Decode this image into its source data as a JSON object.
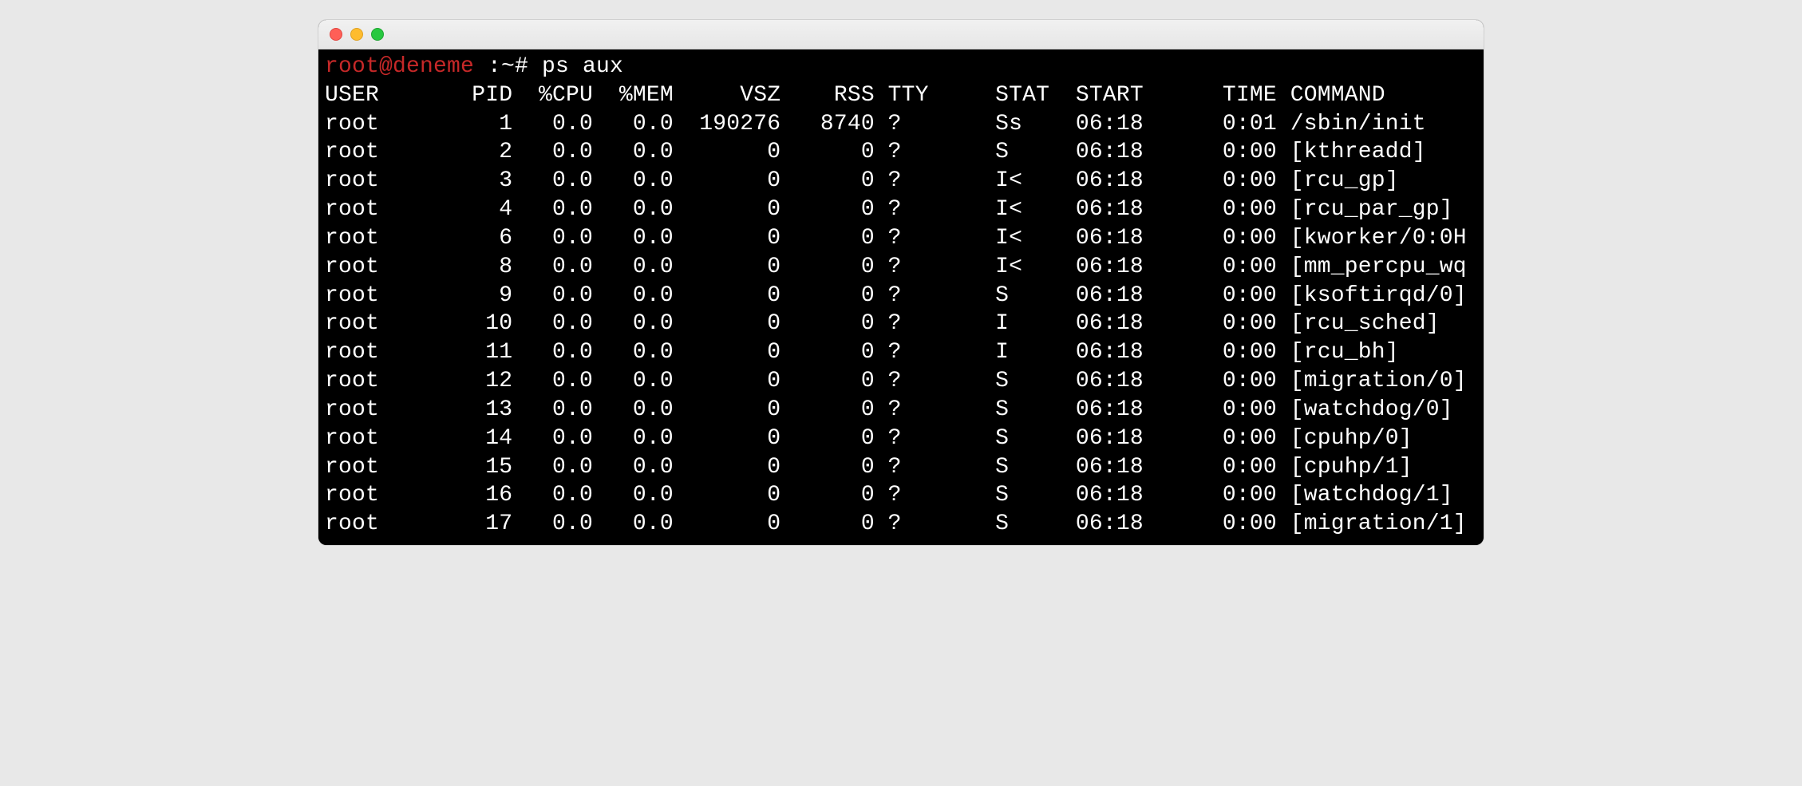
{
  "prompt": {
    "userhost": "root@deneme",
    "rest": " :~# ",
    "command": "ps aux"
  },
  "headers": {
    "user": "USER",
    "pid": "PID",
    "cpu": "%CPU",
    "mem": "%MEM",
    "vsz": "VSZ",
    "rss": "RSS",
    "tty": "TTY",
    "stat": "STAT",
    "start": "START",
    "time": "TIME",
    "cmd": "COMMAND"
  },
  "rows": [
    {
      "user": "root",
      "pid": "1",
      "cpu": "0.0",
      "mem": "0.0",
      "vsz": "190276",
      "rss": "8740",
      "tty": "?",
      "stat": "Ss",
      "start": "06:18",
      "time": "0:01",
      "cmd": "/sbin/init"
    },
    {
      "user": "root",
      "pid": "2",
      "cpu": "0.0",
      "mem": "0.0",
      "vsz": "0",
      "rss": "0",
      "tty": "?",
      "stat": "S",
      "start": "06:18",
      "time": "0:00",
      "cmd": "[kthreadd]"
    },
    {
      "user": "root",
      "pid": "3",
      "cpu": "0.0",
      "mem": "0.0",
      "vsz": "0",
      "rss": "0",
      "tty": "?",
      "stat": "I<",
      "start": "06:18",
      "time": "0:00",
      "cmd": "[rcu_gp]"
    },
    {
      "user": "root",
      "pid": "4",
      "cpu": "0.0",
      "mem": "0.0",
      "vsz": "0",
      "rss": "0",
      "tty": "?",
      "stat": "I<",
      "start": "06:18",
      "time": "0:00",
      "cmd": "[rcu_par_gp]"
    },
    {
      "user": "root",
      "pid": "6",
      "cpu": "0.0",
      "mem": "0.0",
      "vsz": "0",
      "rss": "0",
      "tty": "?",
      "stat": "I<",
      "start": "06:18",
      "time": "0:00",
      "cmd": "[kworker/0:0H"
    },
    {
      "user": "root",
      "pid": "8",
      "cpu": "0.0",
      "mem": "0.0",
      "vsz": "0",
      "rss": "0",
      "tty": "?",
      "stat": "I<",
      "start": "06:18",
      "time": "0:00",
      "cmd": "[mm_percpu_wq"
    },
    {
      "user": "root",
      "pid": "9",
      "cpu": "0.0",
      "mem": "0.0",
      "vsz": "0",
      "rss": "0",
      "tty": "?",
      "stat": "S",
      "start": "06:18",
      "time": "0:00",
      "cmd": "[ksoftirqd/0]"
    },
    {
      "user": "root",
      "pid": "10",
      "cpu": "0.0",
      "mem": "0.0",
      "vsz": "0",
      "rss": "0",
      "tty": "?",
      "stat": "I",
      "start": "06:18",
      "time": "0:00",
      "cmd": "[rcu_sched]"
    },
    {
      "user": "root",
      "pid": "11",
      "cpu": "0.0",
      "mem": "0.0",
      "vsz": "0",
      "rss": "0",
      "tty": "?",
      "stat": "I",
      "start": "06:18",
      "time": "0:00",
      "cmd": "[rcu_bh]"
    },
    {
      "user": "root",
      "pid": "12",
      "cpu": "0.0",
      "mem": "0.0",
      "vsz": "0",
      "rss": "0",
      "tty": "?",
      "stat": "S",
      "start": "06:18",
      "time": "0:00",
      "cmd": "[migration/0]"
    },
    {
      "user": "root",
      "pid": "13",
      "cpu": "0.0",
      "mem": "0.0",
      "vsz": "0",
      "rss": "0",
      "tty": "?",
      "stat": "S",
      "start": "06:18",
      "time": "0:00",
      "cmd": "[watchdog/0]"
    },
    {
      "user": "root",
      "pid": "14",
      "cpu": "0.0",
      "mem": "0.0",
      "vsz": "0",
      "rss": "0",
      "tty": "?",
      "stat": "S",
      "start": "06:18",
      "time": "0:00",
      "cmd": "[cpuhp/0]"
    },
    {
      "user": "root",
      "pid": "15",
      "cpu": "0.0",
      "mem": "0.0",
      "vsz": "0",
      "rss": "0",
      "tty": "?",
      "stat": "S",
      "start": "06:18",
      "time": "0:00",
      "cmd": "[cpuhp/1]"
    },
    {
      "user": "root",
      "pid": "16",
      "cpu": "0.0",
      "mem": "0.0",
      "vsz": "0",
      "rss": "0",
      "tty": "?",
      "stat": "S",
      "start": "06:18",
      "time": "0:00",
      "cmd": "[watchdog/1]"
    },
    {
      "user": "root",
      "pid": "17",
      "cpu": "0.0",
      "mem": "0.0",
      "vsz": "0",
      "rss": "0",
      "tty": "?",
      "stat": "S",
      "start": "06:18",
      "time": "0:00",
      "cmd": "[migration/1]"
    }
  ]
}
